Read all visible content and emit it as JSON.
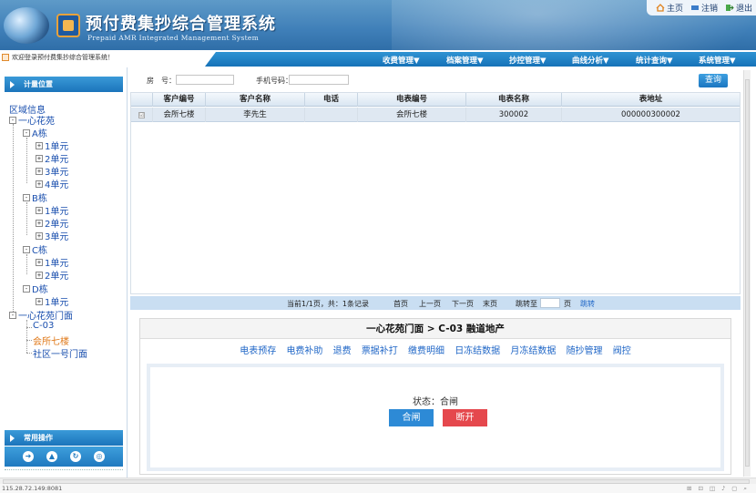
{
  "header": {
    "title": "预付费集抄综合管理系统",
    "subtitle": "Prepaid AMR Integrated Management System",
    "links": [
      {
        "label": "主页",
        "icon": "home-icon"
      },
      {
        "label": "注销",
        "icon": "logout-icon"
      },
      {
        "label": "退出",
        "icon": "exit-icon"
      }
    ]
  },
  "welcome": "欢迎登录预付费集抄综合管理系统！",
  "menu": [
    "收费管理▼",
    "档案管理▼",
    "抄控管理▼",
    "曲线分析▼",
    "统计查询▼",
    "系统管理▼"
  ],
  "sidebar": {
    "position_title": "计量位置",
    "region_label": "区域信息",
    "tree": {
      "root1": "一心花苑",
      "a": "A栋",
      "a1": "1单元",
      "a2": "2单元",
      "a3": "3单元",
      "a4": "4单元",
      "b": "B栋",
      "b1": "1单元",
      "b2": "2单元",
      "b3": "3单元",
      "c": "C栋",
      "c1": "1单元",
      "c2": "2单元",
      "d": "D栋",
      "d1": "1单元",
      "root2": "一心花苑门面",
      "m1": "C-03",
      "m2": "会所七楼",
      "m3": "社区一号门面"
    },
    "common_title": "常用操作",
    "tools": [
      "tool-1-icon",
      "user-icon",
      "refresh-icon",
      "settings-icon"
    ]
  },
  "search": {
    "room_label": "房　号：",
    "phone_label": "手机号码：",
    "query_button": "查询"
  },
  "table": {
    "columns": [
      "",
      "客户编号",
      "客户名称",
      "电话",
      "电表编号",
      "电表名称",
      "表地址"
    ],
    "rows": [
      {
        "check": "☑",
        "customer_no": "会所七楼",
        "customer_name": "李先生",
        "phone": "",
        "meter_no": "会所七楼",
        "meter_name": "300002",
        "address": "000000300002"
      }
    ]
  },
  "pager": {
    "info": "当前1/1页，共：1条记录",
    "first": "首页",
    "prev": "上一页",
    "next": "下一页",
    "last": "末页",
    "jump_to": "跳转至",
    "page_unit": "页",
    "go": "跳转"
  },
  "detail": {
    "title": "一心花苑门面 > C-03   融道地产",
    "tabs": [
      "电表预存",
      "电费补助",
      "退费",
      "票据补打",
      "缴费明细",
      "日冻结数据",
      "月冻结数据",
      "随抄管理",
      "阀控"
    ],
    "status": "状态：合闸",
    "close_button": "合闸",
    "open_button": "断开"
  },
  "statusbar": {
    "url": "115.28.72.149:8081"
  }
}
